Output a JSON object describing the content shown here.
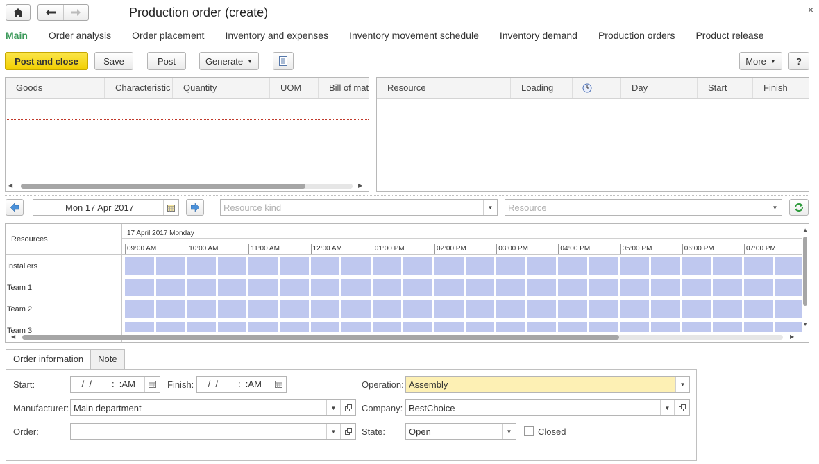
{
  "window": {
    "title": "Production order (create)",
    "close_glyph": "×"
  },
  "icons": {
    "home": "home-icon",
    "back": "arrow-left-icon",
    "forward": "arrow-right-icon"
  },
  "tabs": [
    {
      "label": "Main",
      "active": true
    },
    {
      "label": "Order analysis"
    },
    {
      "label": "Order placement"
    },
    {
      "label": "Inventory and expenses"
    },
    {
      "label": "Inventory movement schedule"
    },
    {
      "label": "Inventory demand"
    },
    {
      "label": "Production orders"
    },
    {
      "label": "Product release"
    }
  ],
  "toolbar": {
    "post_close_label": "Post and close",
    "save_label": "Save",
    "post_label": "Post",
    "generate_label": "Generate",
    "more_label": "More",
    "help_label": "?"
  },
  "goods_table": {
    "columns": [
      "Goods",
      "Characteristic",
      "Quantity",
      "UOM",
      "Bill of mat"
    ]
  },
  "resource_table": {
    "columns": [
      "Resource",
      "Loading",
      "",
      "Day",
      "Start",
      "Finish"
    ]
  },
  "date_nav": {
    "date": "Mon 17 Apr 2017",
    "resource_kind_placeholder": "Resource kind",
    "resource_placeholder": "Resource"
  },
  "gantt": {
    "resources_header": "Resources",
    "date_label": "17 April 2017 Monday",
    "hours": [
      "09:00 AM",
      "10:00 AM",
      "11:00 AM",
      "12:00 AM",
      "01:00 PM",
      "02:00 PM",
      "03:00 PM",
      "04:00 PM",
      "05:00 PM",
      "06:00 PM",
      "07:00 PM"
    ],
    "rows": [
      "Installers",
      "Team 1",
      "Team 2",
      "Team 3"
    ],
    "cell_color": "#bfc8ef"
  },
  "bottom_tabs": [
    "Order information",
    "Note"
  ],
  "form": {
    "start_label": "Start:",
    "start_value": " /  /        :  :AM",
    "finish_label": "Finish:",
    "finish_value": " /  /        :  :AM",
    "operation_label": "Operation:",
    "operation_value": "Assembly",
    "manufacturer_label": "Manufacturer:",
    "manufacturer_value": "Main department",
    "company_label": "Company:",
    "company_value": "BestChoice",
    "order_label": "Order:",
    "order_value": "",
    "state_label": "State:",
    "state_value": "Open",
    "closed_label": "Closed",
    "closed_checked": false
  },
  "colors": {
    "accent_green": "#3d9a5b",
    "primary_button": "#f2cf00",
    "operation_highlight": "#fdf0b4"
  }
}
